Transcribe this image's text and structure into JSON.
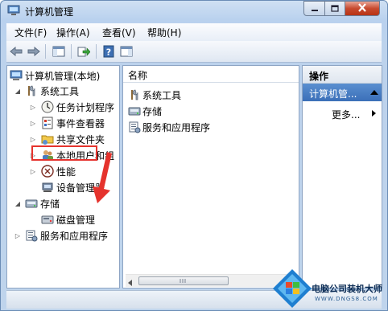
{
  "window": {
    "title": "计算机管理"
  },
  "menubar": {
    "items": [
      "文件(F)",
      "操作(A)",
      "查看(V)",
      "帮助(H)"
    ]
  },
  "toolbar": {
    "buttons": [
      "back-arrow-icon",
      "forward-arrow-icon",
      "show-hide-tree-icon",
      "export-list-icon",
      "help-icon",
      "show-hide-action-pane-icon"
    ]
  },
  "tree": {
    "root": "计算机管理(本地)",
    "system_tools": "系统工具",
    "task_scheduler": "任务计划程序",
    "event_viewer": "事件查看器",
    "shared_folders": "共享文件夹",
    "local_users": "本地用户和组",
    "performance": "性能",
    "device_manager": "设备管理器",
    "storage": "存储",
    "disk_management": "磁盘管理",
    "services_apps": "服务和应用程序"
  },
  "list": {
    "column_header": "名称",
    "items": [
      "系统工具",
      "存储",
      "服务和应用程序"
    ]
  },
  "actions": {
    "title": "操作",
    "section": "计算机管...",
    "more": "更多..."
  },
  "watermark": {
    "text": "电脑公司装机大师",
    "url": "WWW.DNGS8.COM"
  },
  "colors": {
    "highlight": "#e5332d",
    "section": "#3b6fb8"
  }
}
